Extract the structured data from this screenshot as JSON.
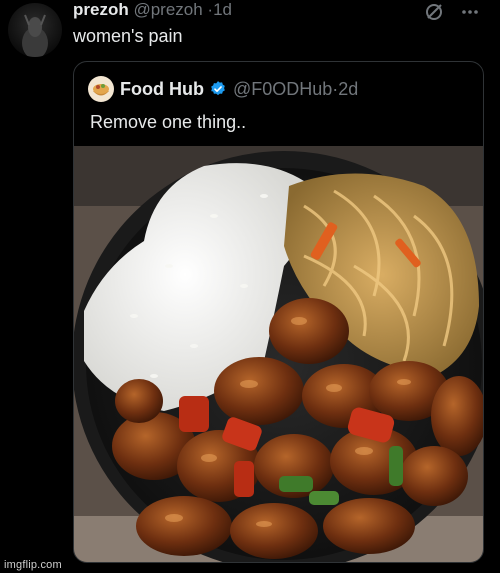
{
  "tweet": {
    "author_name": "prezoh",
    "handle": "@prezoh",
    "separator": "·",
    "time": "1d",
    "text": "women's pain"
  },
  "quote": {
    "author_name": "Food Hub",
    "handle": "@F0ODHub",
    "separator": "·",
    "time": "2d",
    "text": "Remove one thing..",
    "verified_color": "#1d9bf0",
    "media_alt": "Bowl with white rice, stir-fried noodles and sweet chili chicken"
  },
  "icons": {
    "grok": "slash-circle-icon",
    "more": "more-icon",
    "verified": "verified-badge-icon"
  },
  "watermark": "imgflip.com"
}
